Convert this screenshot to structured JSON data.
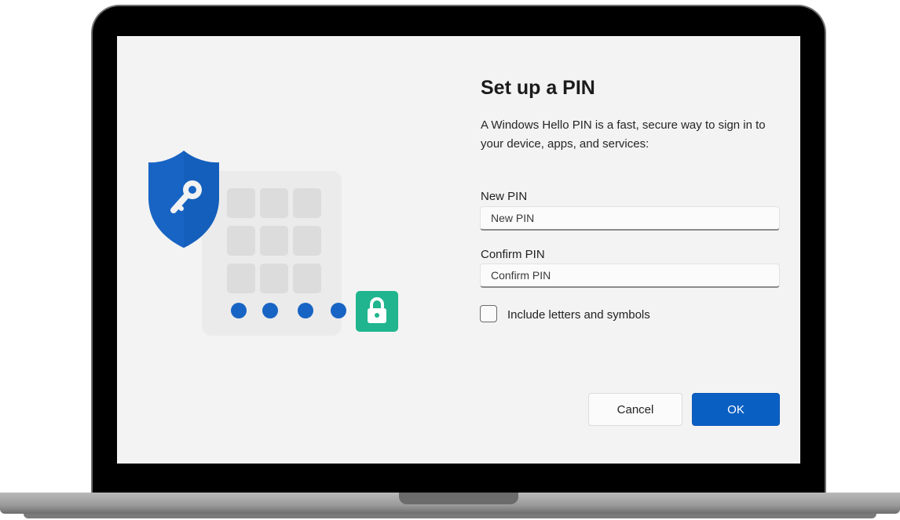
{
  "dialog": {
    "title": "Set up a PIN",
    "description": "A Windows Hello PIN is a fast, secure way to sign in to your device, apps, and services:",
    "new_pin": {
      "label": "New PIN",
      "placeholder": "New PIN",
      "value": ""
    },
    "confirm_pin": {
      "label": "Confirm PIN",
      "placeholder": "Confirm PIN",
      "value": ""
    },
    "include_letters": {
      "label": "Include letters and symbols",
      "checked": false
    },
    "buttons": {
      "cancel": "Cancel",
      "ok": "OK"
    }
  },
  "illustration": {
    "icons": [
      "shield-key-icon",
      "keypad-icon",
      "pin-dots-icon",
      "lock-icon"
    ],
    "pin_dot_count": 4
  },
  "colors": {
    "accent": "#0a5fc2",
    "shield": "#1864c4",
    "lock_badge": "#20b58e",
    "background": "#f3f3f3"
  }
}
